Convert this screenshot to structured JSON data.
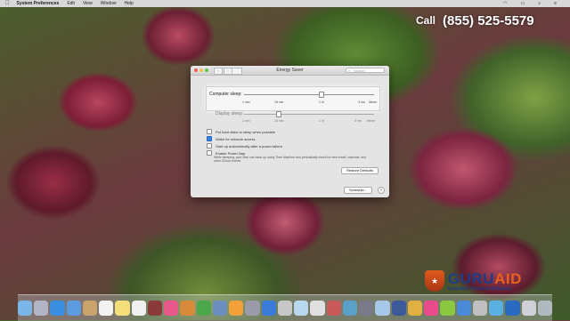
{
  "menubar": {
    "app_name": "System Preferences",
    "items": [
      "Edit",
      "View",
      "Window",
      "Help"
    ]
  },
  "banner": {
    "call_label": "Call",
    "phone": "(855) 525-5579"
  },
  "window": {
    "title": "Energy Saver",
    "search_placeholder": "Search",
    "computer_sleep": {
      "label": "Computer sleep:",
      "ticks": [
        "1 min",
        "15 min",
        "1 hr",
        "3 hrs",
        "Never"
      ]
    },
    "display_sleep": {
      "label": "Display sleep:",
      "ticks": [
        "1 min",
        "15 min",
        "1 hr",
        "3 hrs",
        "Never"
      ]
    },
    "options": [
      {
        "label": "Put hard disks to sleep when possible",
        "checked": false
      },
      {
        "label": "Wake for network access",
        "checked": true
      },
      {
        "label": "Start up automatically after a power failure",
        "checked": false
      },
      {
        "label": "Enable Power Nap",
        "checked": false
      }
    ],
    "power_nap_note": "While sleeping, your Mac can back up using Time Machine and periodically check for new email, calendar, and other iCloud events.",
    "restore_defaults": "Restore Defaults",
    "schedule": "Schedule...",
    "help": "?"
  },
  "logo": {
    "brand_a": "GURU",
    "brand_b": "AID",
    "tagline": "Unrivaled Technical Solutions",
    "colors": {
      "brand_a": "#1b3d8a",
      "brand_b": "#e8621e"
    }
  },
  "dock": {
    "icons": [
      "finder-icon",
      "launchpad-icon",
      "safari-icon",
      "mail-icon",
      "contacts-icon",
      "calendar-icon",
      "notes-icon",
      "reminders-icon",
      "photo-booth-icon",
      "itunes-icon",
      "garageband-icon",
      "evernote-icon",
      "preview-icon",
      "photos-icon",
      "system-preferences-icon",
      "keynote-icon",
      "app-icon",
      "app-icon",
      "app-icon",
      "app-icon",
      "app-icon",
      "app-icon",
      "app-icon",
      "app-icon",
      "app-icon",
      "itunes-icon",
      "app-icon",
      "app-icon",
      "app-icon",
      "app-icon",
      "app-icon",
      "app-icon",
      "trash-icon"
    ]
  }
}
